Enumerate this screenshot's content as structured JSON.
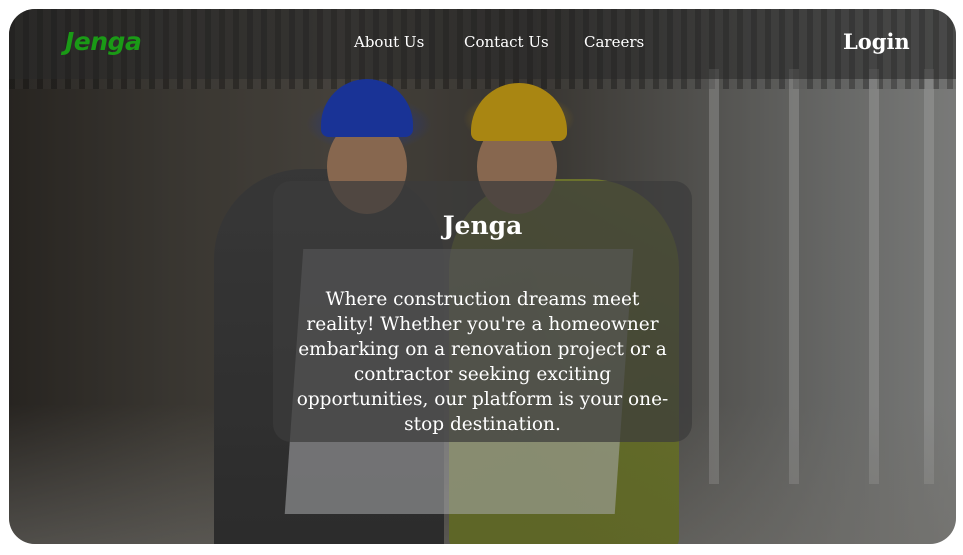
{
  "brand": {
    "logo_text": "Jenga",
    "logo_color": "#1a9a16"
  },
  "nav": {
    "links": [
      {
        "label": "About Us"
      },
      {
        "label": "Contact Us"
      },
      {
        "label": "Careers"
      }
    ],
    "login_label": "Login"
  },
  "hero": {
    "background_subject": "construction-workers-photo",
    "card": {
      "title": "Jenga",
      "text": "Where construction dreams meet reality! Whether you're a homeowner embarking on a renovation project or a contractor seeking exciting opportunities, our platform is your one-stop destination."
    }
  }
}
